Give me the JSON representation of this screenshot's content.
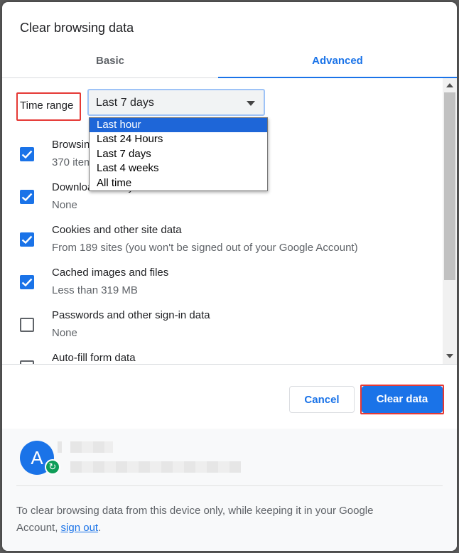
{
  "dialog": {
    "title": "Clear browsing data"
  },
  "tabs": [
    {
      "label": "Basic"
    },
    {
      "label": "Advanced"
    }
  ],
  "time_range": {
    "label": "Time range",
    "selected": "Last 7 days",
    "options": [
      "Last hour",
      "Last 24 Hours",
      "Last 7 days",
      "Last 4 weeks",
      "All time"
    ],
    "highlighted": "Last hour"
  },
  "items": [
    {
      "title": "Browsing history",
      "desc": "370 items",
      "checked": true
    },
    {
      "title": "Download history",
      "desc": "None",
      "checked": true
    },
    {
      "title": "Cookies and other site data",
      "desc": "From 189 sites (you won't be signed out of your Google Account)",
      "checked": true
    },
    {
      "title": "Cached images and files",
      "desc": "Less than 319 MB",
      "checked": true
    },
    {
      "title": "Passwords and other sign-in data",
      "desc": "None",
      "checked": false
    },
    {
      "title": "Auto-fill form data",
      "desc": "",
      "checked": false
    }
  ],
  "buttons": {
    "cancel": "Cancel",
    "clear": "Clear data"
  },
  "account": {
    "avatar_letter": "A"
  },
  "footer": {
    "text": "To clear browsing data from this device only, while keeping it in your Google Account, ",
    "link": "sign out",
    "suffix": "."
  },
  "colors": {
    "accent": "#1a73e8",
    "highlight_box": "#e53935",
    "sync_badge": "#0f9d58"
  }
}
